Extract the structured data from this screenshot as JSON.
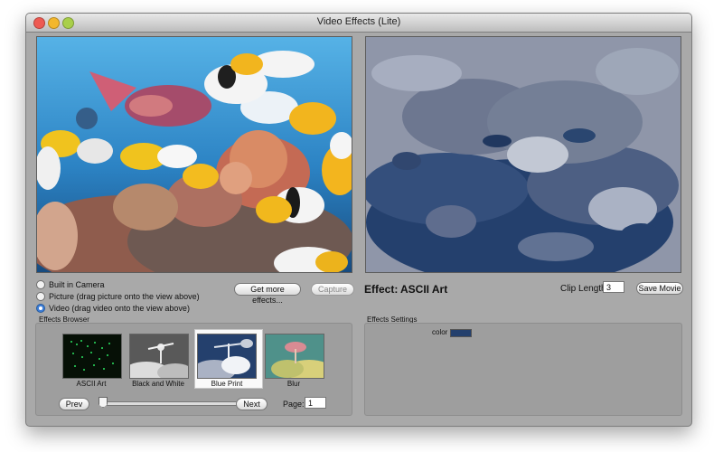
{
  "window": {
    "title": "Video Effects (Lite)"
  },
  "source": {
    "options": [
      {
        "label": "Built in Camera",
        "selected": false
      },
      {
        "label": "Picture (drag picture onto the view above)",
        "selected": false
      },
      {
        "label": "Video (drag video onto the view above)",
        "selected": true
      }
    ]
  },
  "buttons": {
    "get_more_effects": "Get more effects...",
    "capture": "Capture",
    "save_movie": "Save Movie",
    "prev": "Prev",
    "next": "Next"
  },
  "effect": {
    "label": "Effect:",
    "name": "ASCII Art"
  },
  "clip": {
    "label": "Clip Length:",
    "value": "3"
  },
  "effects_browser": {
    "title": "Effects Browser",
    "items": [
      {
        "label": "ASCII Art"
      },
      {
        "label": "Black and White"
      },
      {
        "label": "Blue Print",
        "selected": true
      },
      {
        "label": "Blur"
      }
    ]
  },
  "page": {
    "label": "Page:",
    "value": "1"
  },
  "effects_settings": {
    "title": "Effects Settings",
    "color_label": "color",
    "color_value": "#24406d"
  },
  "colors": {
    "window_bg": "#a9a9a9",
    "preview_blue": "#24406d",
    "preview_gray": "#8f96a9"
  }
}
